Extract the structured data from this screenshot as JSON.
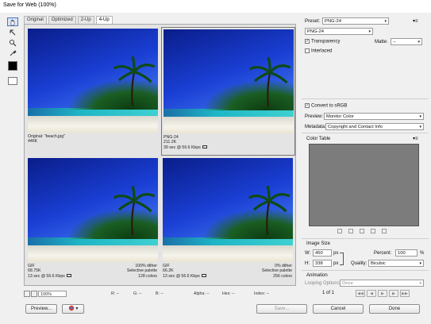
{
  "window": {
    "title": "Save for Web (100%)"
  },
  "tabs": [
    "Original",
    "Optimized",
    "2-Up",
    "4-Up"
  ],
  "active_tab": "4-Up",
  "tools": [
    {
      "name": "hand-tool",
      "icon": "hand-icon"
    },
    {
      "name": "slice-select-tool",
      "icon": "slice-select-icon"
    },
    {
      "name": "zoom-tool",
      "icon": "zoom-icon"
    },
    {
      "name": "eyedropper-tool",
      "icon": "eyedropper-icon"
    }
  ],
  "panes": [
    {
      "id": "original",
      "left": [
        "Original: \"beach.jpg\"",
        "446K"
      ],
      "right": [],
      "selected": false
    },
    {
      "id": "png24",
      "left": [
        "PNG-24",
        "211.2K",
        "39 sec @ 56.6 Kbps"
      ],
      "right": [],
      "selected": true
    },
    {
      "id": "gif1",
      "left": [
        "GIF",
        "68.75K",
        "13 sec @ 56.6 Kbps"
      ],
      "right": [
        "100% dither",
        "Selective palette",
        "128 colors"
      ],
      "selected": false
    },
    {
      "id": "gif2",
      "left": [
        "GIF",
        "66.2K",
        "13 sec @ 56.6 Kbps"
      ],
      "right": [
        "0% dither",
        "Selective palette",
        "256 colors"
      ],
      "selected": false
    }
  ],
  "bottom": {
    "zoom": "100%",
    "r": "R: --",
    "g": "G: --",
    "b": "B: --",
    "alpha": "Alpha: --",
    "hex": "Hex: --",
    "index": "Index: --"
  },
  "buttons": {
    "preview": "Preview...",
    "save": "Save...",
    "cancel": "Cancel",
    "done": "Done"
  },
  "settings": {
    "preset_label": "Preset:",
    "preset_value": "PNG-24",
    "format_value": "PNG-24",
    "transparency_label": "Transparency",
    "transparency_checked": true,
    "matte_label": "Matte:",
    "matte_value": "--",
    "interlaced_label": "Interlaced",
    "interlaced_checked": false,
    "convert_label": "Convert to sRGB",
    "convert_checked": true,
    "preview_label": "Preview:",
    "preview_value": "Monitor Color",
    "metadata_label": "Metadata:",
    "metadata_value": "Copyright and Contact Info",
    "color_table_label": "Color Table"
  },
  "image_size": {
    "label": "Image Size",
    "w_label": "W:",
    "w_value": "450",
    "h_label": "H:",
    "h_value": "338",
    "unit": "px",
    "percent_label": "Percent:",
    "percent_value": "100",
    "percent_unit": "%",
    "quality_label": "Quality:",
    "quality_value": "Bicubic"
  },
  "animation": {
    "label": "Animation",
    "looping_label": "Looping Options:",
    "looping_value": "Once",
    "frame": "1 of 1"
  },
  "colors": {
    "selection": "#4a72b8",
    "color_table_bg": "#7c7c7c"
  }
}
